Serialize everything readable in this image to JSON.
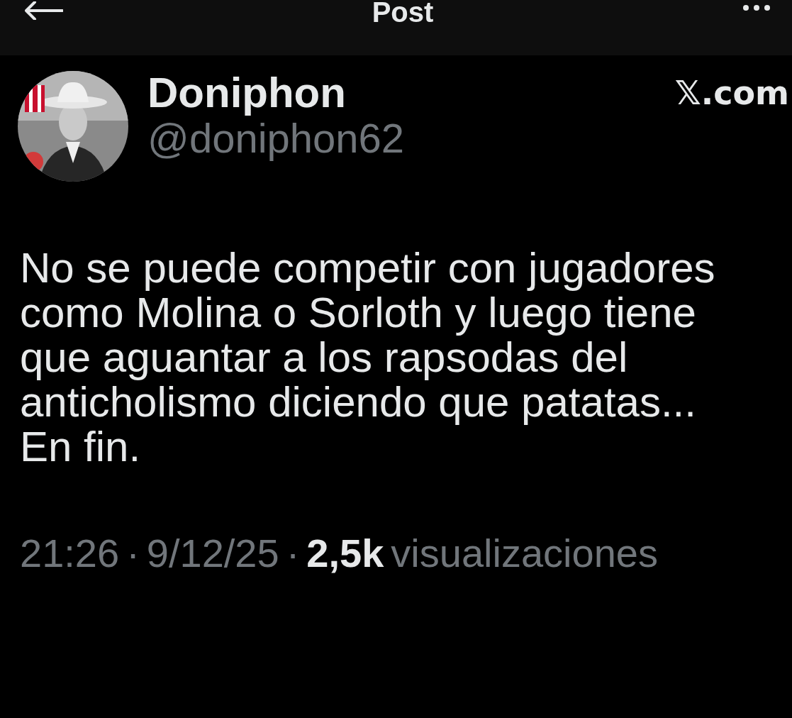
{
  "header": {
    "title": "Post"
  },
  "post": {
    "author": "Doniphon",
    "handle": "@doniphon62",
    "source": "𝕏.com",
    "text": "No se puede competir con jugadores\ncomo Molina o Sorloth  y luego tiene\nque aguantar a los rapsodas del\nanticholismo diciendo que patatas...\nEn fin.",
    "time": "21:26",
    "separator": "·",
    "date": "9/12/25",
    "views_count": "2,5k",
    "views_label": "visualizaciones"
  }
}
